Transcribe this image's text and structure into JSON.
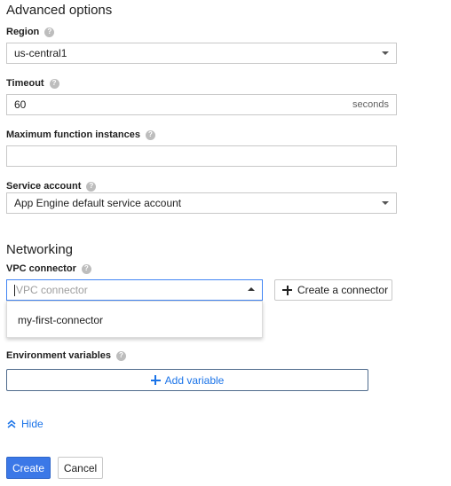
{
  "advanced": {
    "title": "Advanced options"
  },
  "region": {
    "label": "Region",
    "value": "us-central1"
  },
  "timeout": {
    "label": "Timeout",
    "value": "60",
    "suffix": "seconds"
  },
  "max_instances": {
    "label": "Maximum function instances",
    "value": ""
  },
  "service_account": {
    "label": "Service account",
    "value": "App Engine default service account"
  },
  "networking": {
    "title": "Networking"
  },
  "vpc": {
    "label": "VPC connector",
    "placeholder": "VPC connector",
    "create_label": "Create a connector",
    "options": [
      "my-first-connector"
    ]
  },
  "env": {
    "label": "Environment variables",
    "add_label": "Add variable"
  },
  "hide": {
    "label": "Hide"
  },
  "actions": {
    "create_label": "Create",
    "cancel_label": "Cancel"
  },
  "colors": {
    "accent": "#4285f4",
    "link": "#1a73e8",
    "primary_button": "#3b78e7",
    "border": "#c8c8c8"
  },
  "icons": {
    "help": "question-circle-icon",
    "dropdown": "triangle-down-icon",
    "add": "plus-icon",
    "collapse": "double-chevron-up-icon"
  }
}
